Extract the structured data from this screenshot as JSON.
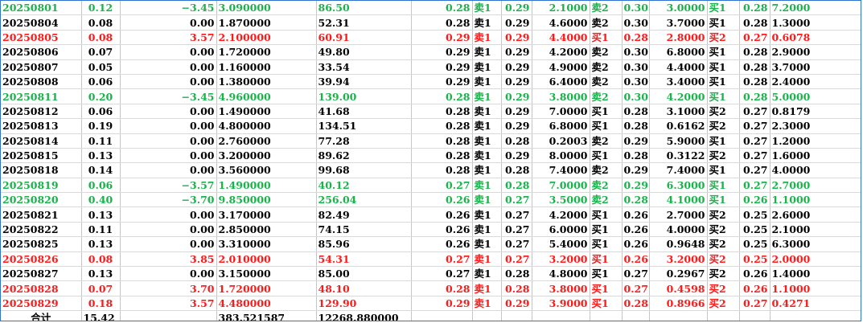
{
  "colors": {
    "up": "#ff1a1a",
    "down": "#1ab24a",
    "flat": "#000000",
    "border": "#2f74d0"
  },
  "rows": [
    {
      "tone": "down",
      "c": [
        "20250801",
        "0.12",
        "−3.45",
        "3.090000",
        "86.50",
        "0.28",
        "卖1",
        "0.29",
        "2.1000",
        "卖2",
        "0.30",
        "3.0000",
        "买1",
        "0.28",
        "7.2000"
      ]
    },
    {
      "tone": "flat",
      "c": [
        "20250804",
        "0.08",
        "0.00",
        "1.870000",
        "52.31",
        "0.28",
        "卖1",
        "0.29",
        "4.6000",
        "卖2",
        "0.30",
        "3.7000",
        "买1",
        "0.28",
        "1.3000"
      ]
    },
    {
      "tone": "up",
      "c": [
        "20250805",
        "0.08",
        "3.57",
        "2.100000",
        "60.91",
        "0.29",
        "卖1",
        "0.29",
        "4.4000",
        "买1",
        "0.28",
        "2.8000",
        "买2",
        "0.27",
        "0.6078"
      ]
    },
    {
      "tone": "flat",
      "c": [
        "20250806",
        "0.07",
        "0.00",
        "1.720000",
        "49.80",
        "0.29",
        "卖1",
        "0.29",
        "4.2000",
        "卖2",
        "0.30",
        "6.8000",
        "买1",
        "0.28",
        "2.9000"
      ]
    },
    {
      "tone": "flat",
      "c": [
        "20250807",
        "0.05",
        "0.00",
        "1.160000",
        "33.54",
        "0.29",
        "卖1",
        "0.29",
        "4.9000",
        "卖2",
        "0.30",
        "4.4000",
        "买1",
        "0.28",
        "3.7000"
      ]
    },
    {
      "tone": "flat",
      "c": [
        "20250808",
        "0.06",
        "0.00",
        "1.380000",
        "39.94",
        "0.29",
        "卖1",
        "0.29",
        "6.4000",
        "卖2",
        "0.30",
        "3.4000",
        "买1",
        "0.28",
        "2.4000"
      ]
    },
    {
      "tone": "down",
      "c": [
        "20250811",
        "0.20",
        "−3.45",
        "4.960000",
        "139.00",
        "0.28",
        "卖1",
        "0.29",
        "3.8000",
        "卖2",
        "0.30",
        "4.2000",
        "买1",
        "0.28",
        "5.0000"
      ]
    },
    {
      "tone": "flat",
      "c": [
        "20250812",
        "0.06",
        "0.00",
        "1.490000",
        "41.68",
        "0.28",
        "卖1",
        "0.29",
        "7.0000",
        "买1",
        "0.28",
        "3.1000",
        "买2",
        "0.27",
        "0.8179"
      ]
    },
    {
      "tone": "flat",
      "c": [
        "20250813",
        "0.19",
        "0.00",
        "4.800000",
        "134.51",
        "0.28",
        "卖1",
        "0.29",
        "6.8000",
        "买1",
        "0.28",
        "0.6162",
        "买2",
        "0.27",
        "2.3000"
      ]
    },
    {
      "tone": "flat",
      "c": [
        "20250814",
        "0.11",
        "0.00",
        "2.760000",
        "77.28",
        "0.28",
        "卖1",
        "0.28",
        "0.2003",
        "卖2",
        "0.29",
        "5.9000",
        "买1",
        "0.27",
        "1.2000"
      ]
    },
    {
      "tone": "flat",
      "c": [
        "20250815",
        "0.13",
        "0.00",
        "3.200000",
        "89.62",
        "0.28",
        "卖1",
        "0.29",
        "8.0000",
        "买1",
        "0.28",
        "0.3122",
        "买2",
        "0.27",
        "1.6000"
      ]
    },
    {
      "tone": "flat",
      "c": [
        "20250818",
        "0.14",
        "0.00",
        "3.560000",
        "99.68",
        "0.28",
        "卖1",
        "0.28",
        "7.4000",
        "卖2",
        "0.29",
        "7.4000",
        "买1",
        "0.27",
        "4.0000"
      ]
    },
    {
      "tone": "down",
      "c": [
        "20250819",
        "0.06",
        "−3.57",
        "1.490000",
        "40.12",
        "0.27",
        "卖1",
        "0.28",
        "7.0000",
        "卖2",
        "0.29",
        "6.3000",
        "买1",
        "0.27",
        "2.7000"
      ]
    },
    {
      "tone": "down",
      "c": [
        "20250820",
        "0.40",
        "−3.70",
        "9.850000",
        "256.04",
        "0.26",
        "卖1",
        "0.27",
        "3.5000",
        "卖2",
        "0.28",
        "4.1000",
        "买1",
        "0.26",
        "1.1000"
      ]
    },
    {
      "tone": "flat",
      "c": [
        "20250821",
        "0.13",
        "0.00",
        "3.170000",
        "82.49",
        "0.26",
        "卖1",
        "0.27",
        "4.2000",
        "买1",
        "0.26",
        "2.7000",
        "买2",
        "0.25",
        "2.6000"
      ]
    },
    {
      "tone": "flat",
      "c": [
        "20250822",
        "0.11",
        "0.00",
        "2.850000",
        "74.15",
        "0.26",
        "卖1",
        "0.27",
        "6.0000",
        "买1",
        "0.26",
        "4.0000",
        "买2",
        "0.25",
        "2.1000"
      ]
    },
    {
      "tone": "flat",
      "c": [
        "20250825",
        "0.13",
        "0.00",
        "3.310000",
        "85.96",
        "0.26",
        "卖1",
        "0.27",
        "5.4000",
        "买1",
        "0.26",
        "0.9648",
        "买2",
        "0.25",
        "6.3000"
      ]
    },
    {
      "tone": "up",
      "c": [
        "20250826",
        "0.08",
        "3.85",
        "2.010000",
        "54.31",
        "0.27",
        "卖1",
        "0.27",
        "3.2000",
        "买1",
        "0.26",
        "3.2000",
        "买2",
        "0.25",
        "2.0000"
      ]
    },
    {
      "tone": "flat",
      "c": [
        "20250827",
        "0.13",
        "0.00",
        "3.150000",
        "85.00",
        "0.27",
        "卖1",
        "0.28",
        "4.8000",
        "买1",
        "0.27",
        "0.2967",
        "买2",
        "0.26",
        "1.4000"
      ]
    },
    {
      "tone": "up",
      "c": [
        "20250828",
        "0.07",
        "3.70",
        "1.720000",
        "48.10",
        "0.28",
        "卖1",
        "0.28",
        "3.8000",
        "买1",
        "0.27",
        "0.4598",
        "买2",
        "0.26",
        "1.1000"
      ]
    },
    {
      "tone": "up",
      "c": [
        "20250829",
        "0.18",
        "3.57",
        "4.480000",
        "129.90",
        "0.29",
        "卖1",
        "0.29",
        "3.9000",
        "买1",
        "0.28",
        "0.8966",
        "买2",
        "0.27",
        "0.4271"
      ]
    }
  ],
  "total": {
    "label": "合计",
    "c2": "15.42",
    "c4": "383.521587",
    "c5": "12268.880000"
  }
}
